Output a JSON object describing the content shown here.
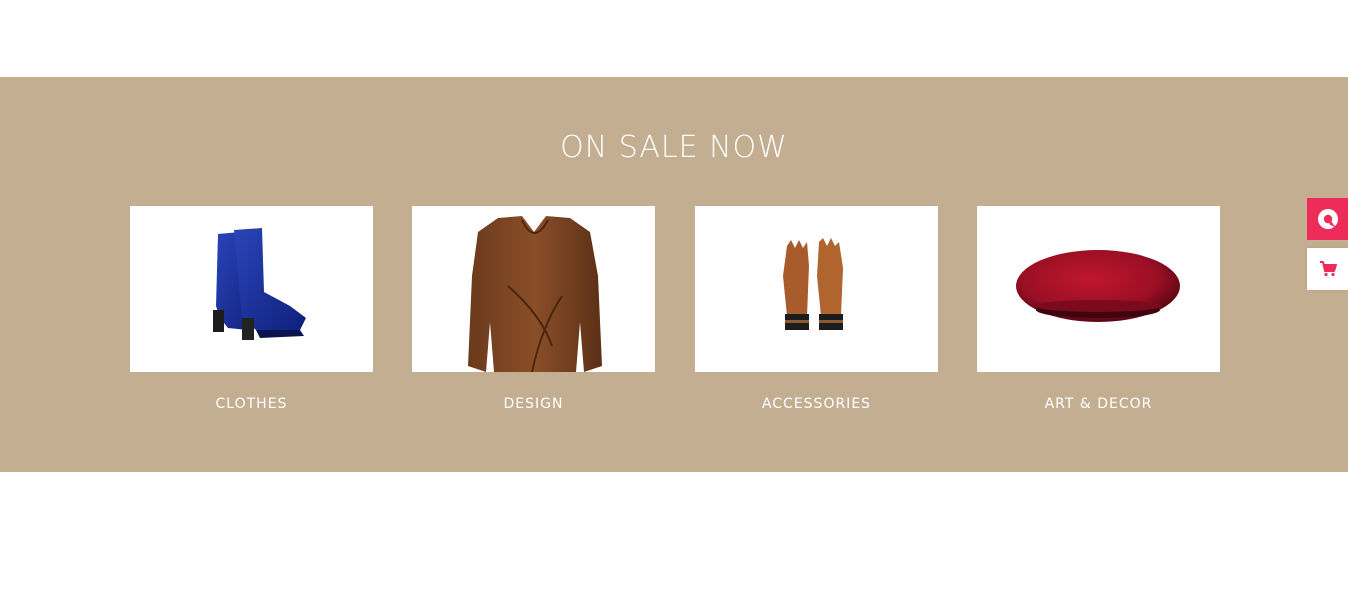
{
  "section": {
    "title": "ON SALE NOW"
  },
  "categories": [
    {
      "label": "CLOTHES",
      "image": "blue-velvet-ankle-boots"
    },
    {
      "label": "DESIGN",
      "image": "brown-wrap-dress"
    },
    {
      "label": "ACCESSORIES",
      "image": "brown-leather-gloves"
    },
    {
      "label": "ART & DECOR",
      "image": "red-fur-beret"
    }
  ],
  "side_tabs": [
    {
      "icon": "chat-icon"
    },
    {
      "icon": "cart-icon"
    }
  ],
  "colors": {
    "band": "#c4ae91",
    "accent": "#ee2c5a",
    "text": "#ffffff"
  }
}
